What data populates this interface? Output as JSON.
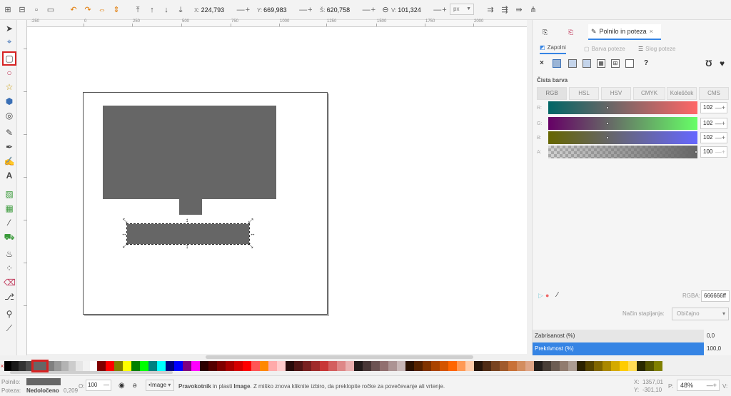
{
  "toolbar": {
    "x_label": "X:",
    "x_value": "224,793",
    "y_label": "Y:",
    "y_value": "669,983",
    "w_label": "Š:",
    "w_value": "620,758",
    "h_label": "V:",
    "h_value": "101,324",
    "plusminus": "—+",
    "unit": "px"
  },
  "ruler": {
    "labels": [
      "-250",
      "0",
      "250",
      "500",
      "750",
      "1000",
      "1250",
      "1500",
      "1750",
      "2000"
    ]
  },
  "panel": {
    "tab1_icon": "document-properties-icon",
    "tab2_icon": "snap-icon",
    "tab3_label": "Polnilo in poteza",
    "tab3_close": "×",
    "sub_fill": "Zapolni",
    "sub_stroke_paint": "Barva poteze",
    "sub_stroke_style": "Slog poteze",
    "paint_none": "×",
    "paint_unset": "?",
    "flat_color_label": "Čista barva",
    "modes": [
      "RGB",
      "HSL",
      "HSV",
      "CMYK",
      "Kolešček",
      "CMS"
    ],
    "r_label": "R:",
    "r_value": "102",
    "g_label": "G:",
    "g_value": "102",
    "b_label": "B:",
    "b_value": "102",
    "a_label": "A:",
    "a_value": "100",
    "rgba_label": "RGBA:",
    "rgba_value": "666666ff",
    "blend_label": "Način stapljanja:",
    "blend_value": "Običajno",
    "blur_label": "Zabrisanost (%)",
    "blur_value": "0,0",
    "opacity_label": "Prekrivnost (%)",
    "opacity_value": "100,0"
  },
  "colors": {
    "shape_fill": "#666666",
    "accent": "#3584e4",
    "highlight": "#d62222"
  },
  "status": {
    "fill_label": "Polnilo:",
    "stroke_label": "Poteza:",
    "stroke_value": "Nedoločeno",
    "stroke_width": "0,209",
    "opacity_label": "O:",
    "opacity_value": "100",
    "layer_name": "•Image",
    "message_bold": "Pravokotnik",
    "message_pre": " in plasti ",
    "message_layer": "Image",
    "message_rest": ". Z miško znova kliknite izbiro, da preklopite ročke za povečevanje ali vrtenje.",
    "cx_label": "X:",
    "cx_value": "1357,01",
    "cy_label": "Y:",
    "cy_value": "-301,10",
    "zoom_label": "P:",
    "zoom_value": "48%",
    "rot_label": "V:"
  }
}
